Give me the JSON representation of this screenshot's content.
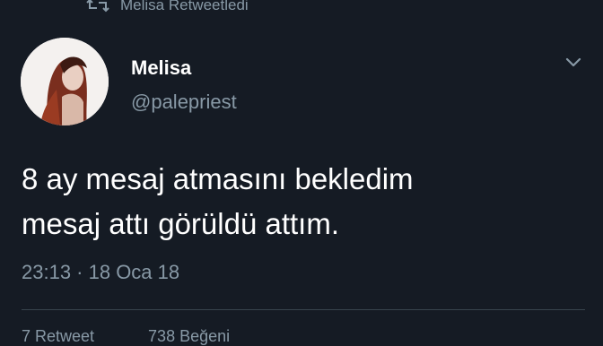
{
  "retweet": {
    "label": "Melisa Retweetledi",
    "icon": "retweet-icon"
  },
  "tweet": {
    "author_name": "Melisa",
    "author_handle": "@palepriest",
    "text_lines": [
      "8 ay mesaj atmasını bekledim",
      "mesaj attı görüldü attım."
    ],
    "timestamp": "23:13 · 18 Oca 18"
  },
  "stats": {
    "retweets": "7 Retweet",
    "likes": "738 Beğeni"
  },
  "colors": {
    "background": "#151b24",
    "muted": "#8899a6",
    "text": "#ffffff",
    "divider": "#38444d"
  }
}
